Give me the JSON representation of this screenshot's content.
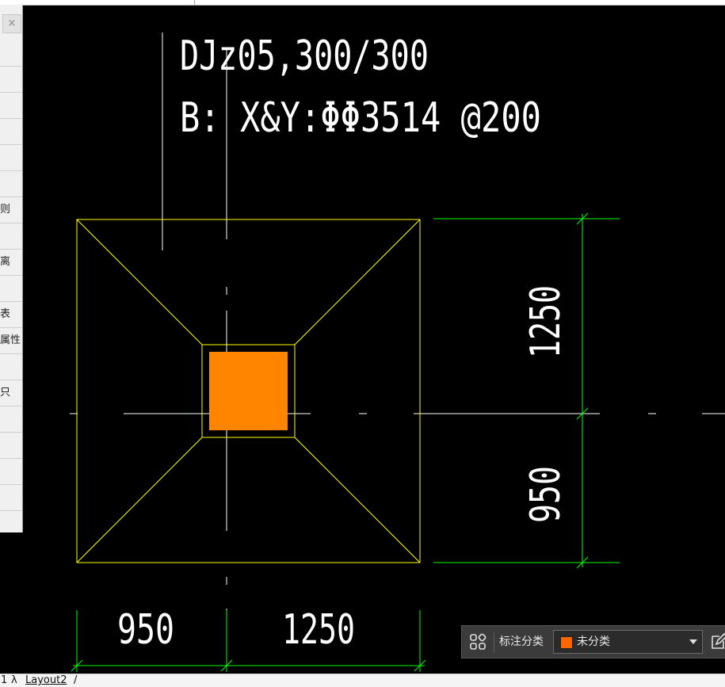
{
  "window": {
    "title": ""
  },
  "side_palette": {
    "close_glyph": "×",
    "rows": [
      "",
      "",
      "",
      "",
      "",
      "",
      "则",
      "",
      "离",
      "",
      "表",
      "属性",
      "",
      "只",
      "",
      "",
      "",
      "",
      "",
      ""
    ]
  },
  "drawing": {
    "label_line1": "DJz05,300/300",
    "label_line2": "B:  X&Y:ΦΦ3514 @200",
    "dim_right_top": "1250",
    "dim_right_bottom": "950",
    "dim_bottom_left": "950",
    "dim_bottom_right": "1250",
    "colors": {
      "background": "#000000",
      "footing_outline": "#ffff00",
      "column_fill": "#ff8400",
      "dimension": "#00ff00",
      "text": "#ffffff",
      "axis": "#ffffff"
    }
  },
  "annotation_toolbar": {
    "icon": "grid-icon",
    "label": "标注分类",
    "category_value": "未分类",
    "category_color": "#ff6600",
    "edit_icon": "edit-icon"
  },
  "layout_tabs": {
    "tab_model_fragment": "1",
    "tab_layout1_fragment": "λ",
    "tab_layout2": "Layout2",
    "tail": "/"
  }
}
